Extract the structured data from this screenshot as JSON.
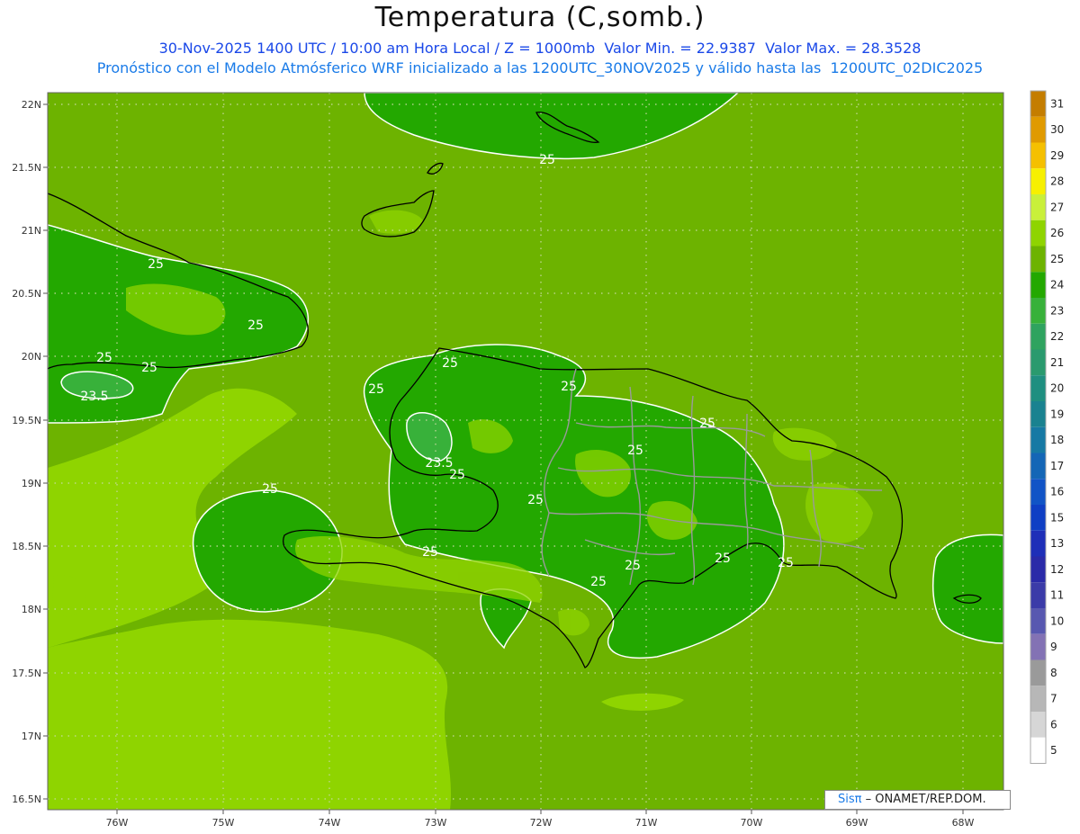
{
  "title": "Temperatura (C,somb.)",
  "subtitle_line1": "30-Nov-2025 1400 UTC / 10:00 am Hora Local / Z = 1000mb  Valor Min. = 22.9387  Valor Max. = 28.3528",
  "subtitle_line2": "Pronóstico con el Modelo Atmósferico WRF inicializado a las 1200UTC_30NOV2025 y válido hasta las  1200UTC_02DIC2025",
  "lat_ticks": [
    "22N",
    "21.5N",
    "21N",
    "20.5N",
    "20N",
    "19.5N",
    "19N",
    "18.5N",
    "18N",
    "17.5N",
    "17N",
    "16.5N"
  ],
  "lon_ticks": [
    "76W",
    "75W",
    "74W",
    "73W",
    "72W",
    "71W",
    "70W",
    "69W",
    "68W"
  ],
  "colorbar_labels": [
    "31",
    "30",
    "29",
    "28",
    "27",
    "26",
    "25",
    "24",
    "23",
    "22",
    "21",
    "20",
    "19",
    "18",
    "17",
    "16",
    "15",
    "13",
    "12",
    "11",
    "10",
    "9",
    "8",
    "7",
    "6",
    "5"
  ],
  "colorbar_colors": [
    "#c47d00",
    "#e09a00",
    "#f5c000",
    "#f7f000",
    "#c9f03a",
    "#8fd400",
    "#6db300",
    "#23a800",
    "#38b13a",
    "#2fa35f",
    "#2a9a6e",
    "#1f8f80",
    "#1a8290",
    "#1679a4",
    "#1466b6",
    "#1154c6",
    "#0f3fc4",
    "#1e2fb8",
    "#2a2aa8",
    "#3b3ba8",
    "#5858b0",
    "#8372b4",
    "#9a9a9a",
    "#b7b7b7",
    "#d6d6d6",
    "#ffffff"
  ],
  "contour_labels": [
    {
      "text": "25"
    },
    {
      "text": "25"
    },
    {
      "text": "25"
    },
    {
      "text": "25"
    },
    {
      "text": "25"
    },
    {
      "text": "25"
    },
    {
      "text": "25"
    },
    {
      "text": "25"
    },
    {
      "text": "25"
    },
    {
      "text": "25"
    },
    {
      "text": "25"
    },
    {
      "text": "25"
    },
    {
      "text": "25"
    },
    {
      "text": "25"
    },
    {
      "text": "25"
    },
    {
      "text": "25"
    },
    {
      "text": "25"
    },
    {
      "text": "25"
    },
    {
      "text": "23.5"
    },
    {
      "text": "23.5"
    }
  ],
  "credit_logo": "Sisπ",
  "credit_text": "– ONAMET/REP.DOM."
}
